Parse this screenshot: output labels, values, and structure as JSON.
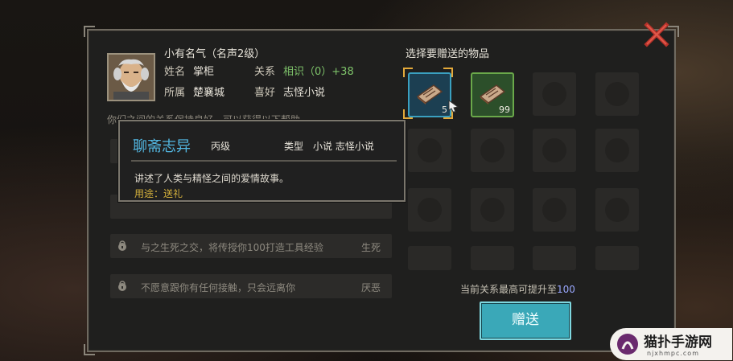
{
  "npc": {
    "title": "小有名气（名声2级）",
    "name_label": "姓名",
    "name_value": "掌柜",
    "relation_label": "关系",
    "relation_value": "相识（0）+38",
    "faction_label": "所属",
    "faction_value": "楚襄城",
    "hobby_label": "喜好",
    "hobby_value": "志怪小说"
  },
  "hint_text": "你们之间的关系保持良好，可以获得以下帮助",
  "relations": [
    {
      "text": "与之生死之交，将传授你100打造工具经验",
      "tag": "生死"
    },
    {
      "text": "不愿意跟你有任何接触，只会远离你",
      "tag": "厌恶"
    }
  ],
  "gift": {
    "title": "选择要赠送的物品",
    "items": [
      {
        "icon": "book-icon",
        "count": "5",
        "selected": true
      },
      {
        "icon": "book-icon",
        "count": "99",
        "selected": false
      }
    ],
    "limit_text": "当前关系最高可提升至",
    "limit_value": "100",
    "button_label": "赠送"
  },
  "tooltip": {
    "name": "聊斋志异",
    "grade": "丙级",
    "type_label": "类型",
    "type_value": "小说 志怪小说",
    "description": "讲述了人类与精怪之间的爱情故事。",
    "usage": "用途：送礼"
  },
  "watermark": {
    "text": "猫扑手游网",
    "url": "njxhmpc.com"
  },
  "colors": {
    "tooltip_name": "#52b6e0",
    "relation_green": "#7ec36a",
    "button_bg": "#3aa8b8",
    "selected_frame": "#e4a93a"
  }
}
